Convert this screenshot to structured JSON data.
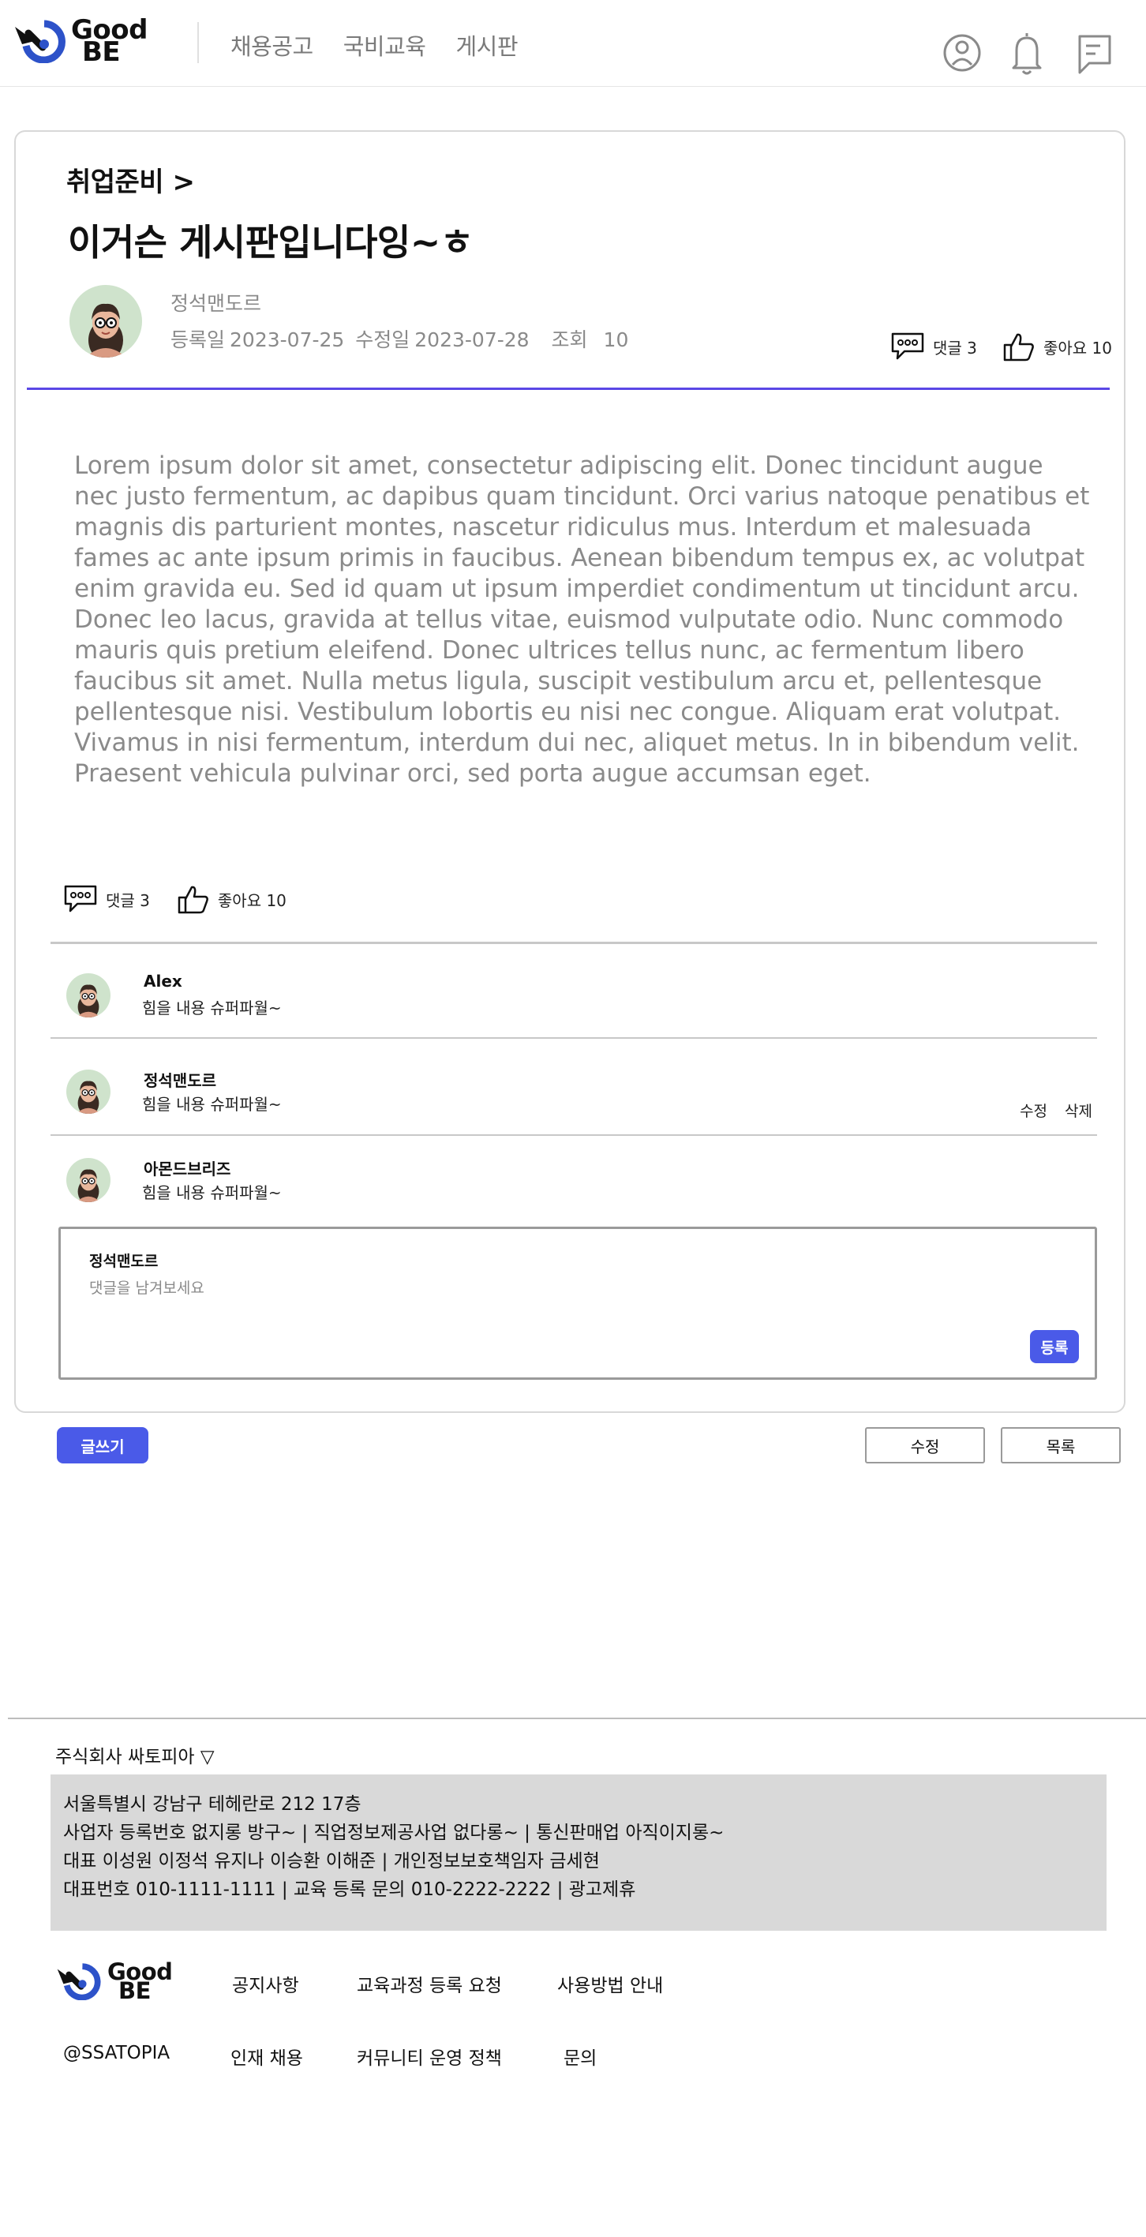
{
  "header": {
    "logo_top": "Good",
    "logo_bottom": "BE",
    "nav": [
      "채용공고",
      "국비교육",
      "게시판"
    ],
    "icons": [
      "user-icon",
      "bell-icon",
      "message-icon"
    ]
  },
  "post": {
    "breadcrumb": "취업준비 >",
    "title": "이거슨 게시판입니다잉~ㅎ",
    "author": "정석맨도르",
    "created_label": "등록일",
    "created": "2023-07-25",
    "updated_label": "수정일",
    "updated": "2023-07-28",
    "views_label": "조회",
    "views": "10",
    "comments_stat": "댓글 3",
    "likes_stat": "좋아요 10",
    "body": "Lorem ipsum dolor sit amet, consectetur adipiscing elit. Donec tincidunt augue nec justo fermentum, ac dapibus quam tincidunt. Orci varius natoque penatibus et magnis dis parturient montes, nascetur ridiculus mus. Interdum et malesuada fames ac ante ipsum primis in faucibus. Aenean bibendum tempus ex, ac volutpat enim gravida eu. Sed id quam ut ipsum imperdiet condimentum ut tincidunt arcu. Donec leo lacus, gravida at tellus vitae, euismod vulputate odio. Nunc commodo mauris quis pretium eleifend. Donec ultrices tellus nunc, ac fermentum libero faucibus sit amet. Nulla metus ligula, suscipit vestibulum arcu et, pellentesque pellentesque nisi. Vestibulum lobortis eu nisi nec congue. Aliquam erat volutpat. Vivamus in nisi fermentum, interdum dui nec, aliquet metus. In in bibendum velit. Praesent vehicula pulvinar orci, sed porta augue accumsan eget."
  },
  "comments": [
    {
      "name": "Alex",
      "text": "힘을 내용 슈퍼파월~"
    },
    {
      "name": "정석맨도르",
      "text": "힘을 내용 슈퍼파월~",
      "edit": "수정",
      "delete": "삭제"
    },
    {
      "name": "아몬드브리즈",
      "text": "힘을 내용 슈퍼파월~"
    }
  ],
  "comment_form": {
    "user": "정석맨도르",
    "placeholder": "댓글을 남겨보세요",
    "submit": "등록"
  },
  "actions": {
    "write": "글쓰기",
    "edit": "수정",
    "list": "목록"
  },
  "footer": {
    "company": "주식회사 싸토피아 ▽",
    "info": [
      "서울특별시 강남구 테헤란로 212 17층",
      "사업자 등록번호  없지롱 방구~ | 직업정보제공사업 없다롱~ | 통신판매업 아직이지롱~",
      "대표 이성원 이정석 유지나 이승환 이해준 | 개인정보보호책임자 금세현",
      "대표번호 010-1111-1111 | 교육 등록 문의 010-2222-2222 | 광고제휴"
    ],
    "logo_top": "Good",
    "logo_bottom": "BE",
    "links_row1": [
      "공지사항",
      "교육과정 등록 요청",
      "사용방법 안내"
    ],
    "handle": "@SSATOPIA",
    "links_row2": [
      "인재 채용",
      "커뮤니티 운영 정책",
      "문의"
    ]
  },
  "colors": {
    "accent": "#4a5ae8",
    "divider": "#5a47e6",
    "muted_text": "#8a8a8a",
    "avatar_bg": "#cfe3cc"
  }
}
